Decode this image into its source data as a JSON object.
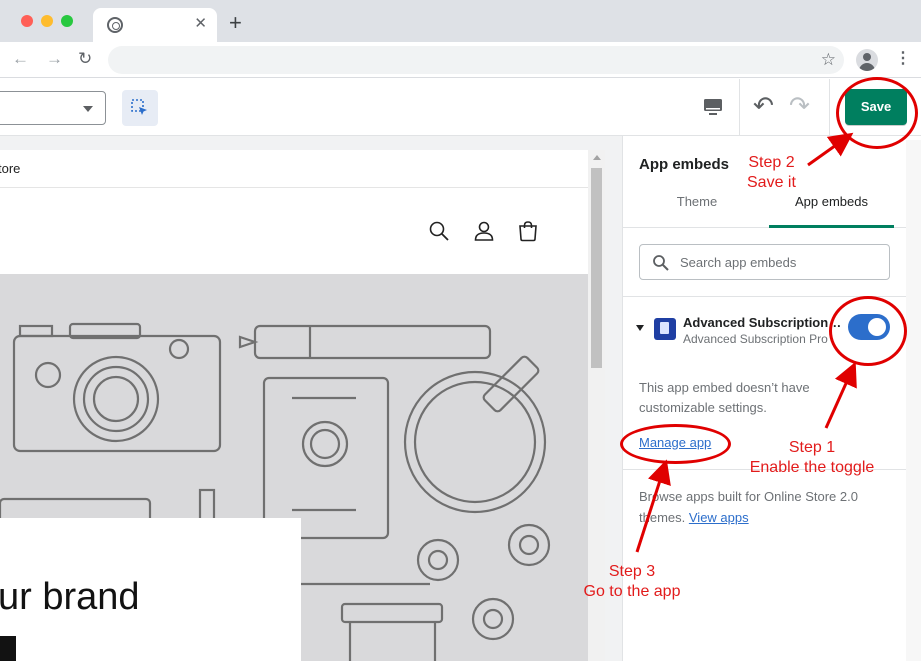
{
  "browser": {
    "tab_close": "✕",
    "new_tab": "+",
    "back": "←",
    "forward": "→",
    "reload": "↻",
    "bookmark": "☆",
    "menu": "⋮"
  },
  "toolbar": {
    "save_label": "Save",
    "undo_icon": "↶",
    "redo_icon": "↷"
  },
  "preview": {
    "announcement": "tore",
    "hero_heading": "ur brand"
  },
  "panel": {
    "title": "App embeds",
    "tabs": [
      {
        "label": "Theme",
        "active": false
      },
      {
        "label": "App embeds",
        "active": true
      }
    ],
    "search_placeholder": "Search app embeds",
    "app": {
      "name": "Advanced Subscription…",
      "subtitle": "Advanced Subscription Pro",
      "enabled": true,
      "note": "This app embed doesn’t have customizable settings.",
      "manage_label": "Manage app"
    },
    "browse_text": "Browse apps built for Online Store 2.0 themes.",
    "view_apps_label": "View apps"
  },
  "annotations": {
    "step2_title": "Step 2",
    "step2_desc": "Save it",
    "step1_title": "Step 1",
    "step1_desc": "Enable the toggle",
    "step3_title": "Step 3",
    "step3_desc": "Go to the app"
  },
  "colors": {
    "save": "#007f5f",
    "toggle": "#2c6ecb",
    "link": "#2c6ecb",
    "annotation": "#e00000"
  },
  "icons": [
    "chrome-icon",
    "back-icon",
    "forward-icon",
    "reload-icon",
    "star-icon",
    "profile-icon",
    "kebab-icon",
    "select-caret-icon",
    "inspect-icon",
    "desktop-icon",
    "undo-icon",
    "redo-icon",
    "search-icon",
    "account-icon",
    "cart-icon",
    "app-icon"
  ]
}
